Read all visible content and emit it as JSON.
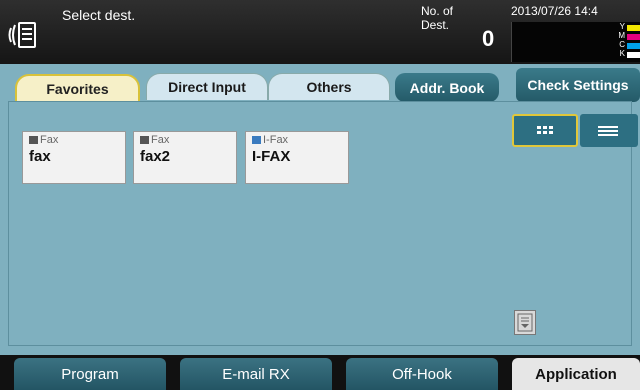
{
  "header": {
    "title": "Select dest.",
    "dest_label_line1": "No. of",
    "dest_label_line2": "Dest.",
    "dest_count": "0",
    "datetime": "2013/07/26 14:4",
    "toner": [
      {
        "label": "Y",
        "color": "#f2e600"
      },
      {
        "label": "M",
        "color": "#e6007e"
      },
      {
        "label": "C",
        "color": "#00a0e9"
      },
      {
        "label": "K",
        "color": "#ffffff"
      }
    ]
  },
  "tabs": {
    "favorites": "Favorites",
    "direct_input": "Direct Input",
    "others": "Others"
  },
  "actions": {
    "addr_book": "Addr. Book",
    "check_settings": "Check Settings"
  },
  "destinations": [
    {
      "type": "Fax",
      "name": "fax",
      "icon": "fax-icon"
    },
    {
      "type": "Fax",
      "name": "fax2",
      "icon": "fax-icon"
    },
    {
      "type": "I-Fax",
      "name": "I-FAX",
      "icon": "ifax-icon"
    }
  ],
  "footer": {
    "program": "Program",
    "email_rx": "E-mail RX",
    "off_hook": "Off-Hook",
    "application": "Application"
  }
}
